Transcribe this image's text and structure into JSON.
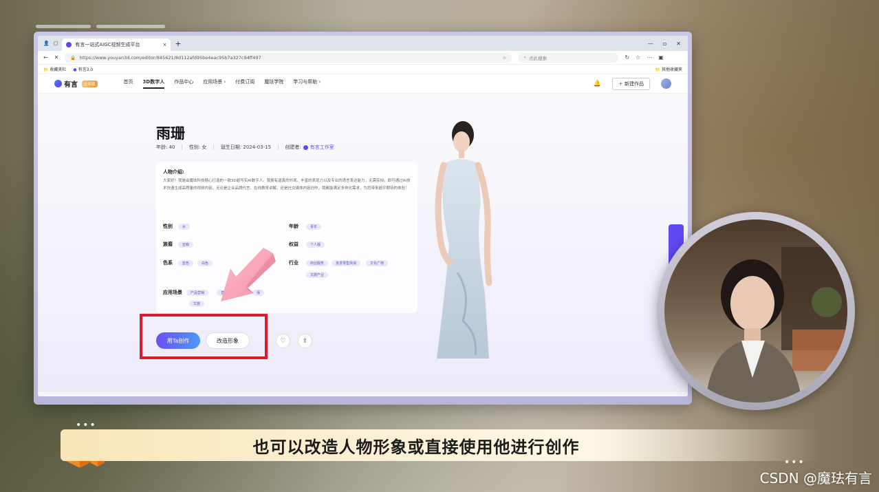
{
  "browser": {
    "tab_title": "有言一站式AIGC视频生成平台",
    "tab_close": "×",
    "new_tab": "+",
    "url": "https://www.youyan3d.com/editor/845621/8d112afd95be4eac95b7a327c94ff497",
    "search_placeholder": "点此搜索",
    "bookmarks": [
      "收藏夹栏",
      "有言3.0"
    ],
    "other_bookmarks": "其他收藏夹",
    "window_controls": [
      "—",
      "▫",
      "✕"
    ]
  },
  "site_nav": {
    "logo": "有言",
    "badge": "企业版",
    "items": [
      "首页",
      "3D数字人",
      "作品中心",
      "应用场景 ›",
      "付费订阅",
      "魔珐学院",
      "学习与帮助 ›"
    ],
    "active_index": 1,
    "new_work": "＋ 新建作品"
  },
  "profile": {
    "name": "雨珊",
    "age": "年龄: 40",
    "gender": "性别: 女",
    "birthday": "诞生日期: 2024-03-15",
    "creator_label": "创建者:",
    "creator": "有言工作室",
    "intro_title": "人物介绍:",
    "intro_text": "大家好！我是由魔珐科技精心打造的一款3D超写实AI数字人。我拥有逼真的外观、丰富的表现力以及专业的语言表达能力，无需实拍，即可通过AI技术快速生成高质量的视频内容。无论是企业品牌代言、在线教育讲解，还是社交媒体内容创作，我都能满足多样化需求，为您带来超乎期待的体验！",
    "attrs": {
      "gender_label": "性别",
      "gender_tags": [
        "女"
      ],
      "age_label": "年龄",
      "age_tags": [
        "青年"
      ],
      "ethnic_label": "族裔",
      "ethnic_tags": [
        "亚裔"
      ],
      "rights_label": "权益",
      "rights_tags": [
        "个人版"
      ],
      "color_label": "色系",
      "color_tags": [
        "蓝色",
        "白色"
      ],
      "industry_label": "行业",
      "industry_tags": [
        "商业服务",
        "批发零售快消",
        "文化广电",
        "文旅产业"
      ],
      "scene_label": "应用场景",
      "scene_tags": [
        "产品营销",
        "直",
        "保",
        "文旅"
      ]
    },
    "use_button": "用Ta创作",
    "edit_button": "改造形象"
  },
  "caption": "也可以改造人物形象或直接使用他进行创作",
  "watermark": "CSDN @魔珐有言",
  "colors": {
    "accent": "#5f49f2",
    "highlight_box": "#d81e2c"
  }
}
